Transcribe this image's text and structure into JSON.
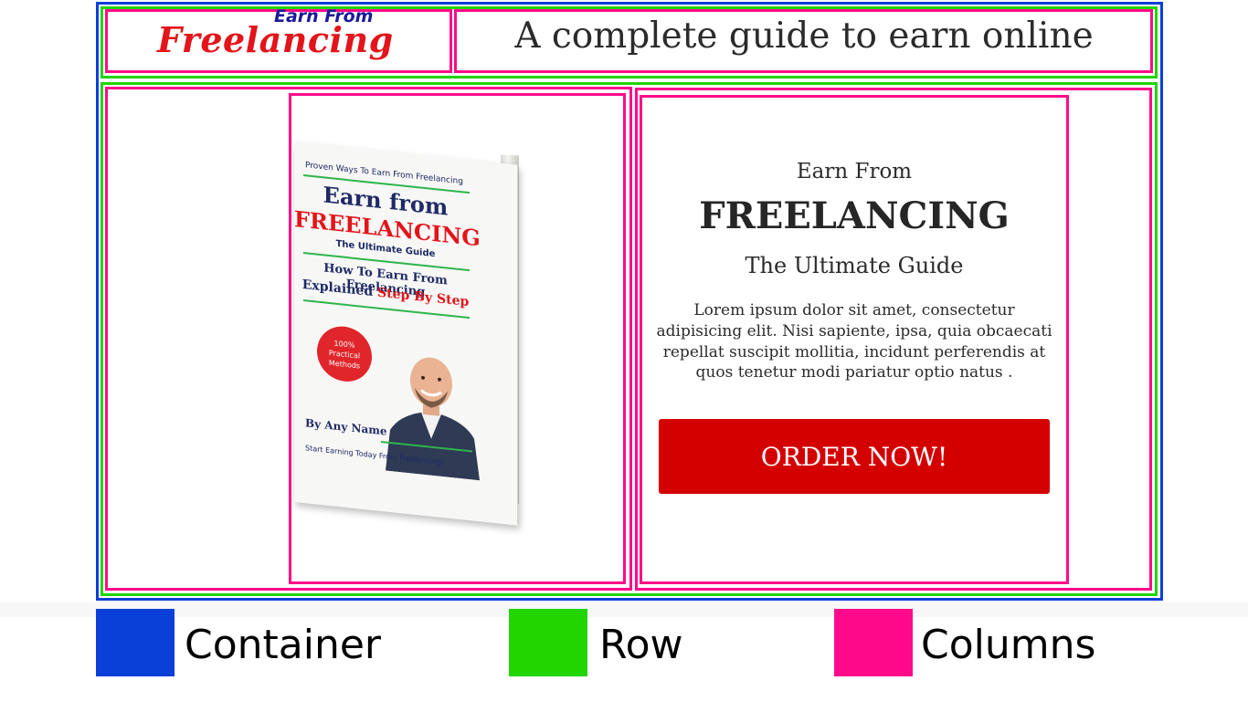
{
  "header": {
    "logo_top": "Earn From",
    "logo_main": "Freelancing",
    "title": "A complete guide to earn online"
  },
  "book_cover": {
    "top_line": "Proven Ways To Earn From Freelancing",
    "title_line1": "Earn from",
    "title_line2": "FREELANCING",
    "subtitle": "The Ultimate Guide",
    "tagline1": "How To Earn From Freelancing",
    "tagline2": "Explained",
    "tagline2_highlight": "Step By Step",
    "badge_line1": "100%",
    "badge_line2": "Practical",
    "badge_line3": "Methods",
    "author": "By Any Name",
    "bottom_line": "Start Earning Today From Freelancing!"
  },
  "product": {
    "earn_from": "Earn From",
    "heading": "FREELANCING",
    "subtitle": "The Ultimate Guide",
    "description": "Lorem ipsum dolor sit amet, consectetur adipisicing elit. Nisi sapiente, ipsa, quia obcaecati repellat suscipit mollitia, incidunt perferendis at quos tenetur modi pariatur optio natus .",
    "order_button": "ORDER NOW!"
  },
  "legend": [
    {
      "label": "Container",
      "color": "#0a3fd8"
    },
    {
      "label": "Row",
      "color": "#22d400"
    },
    {
      "label": "Columns",
      "color": "#ff0a8a"
    }
  ],
  "colors": {
    "container": "#0a3fd8",
    "row": "#22d400",
    "column": "#ff0a8a",
    "button": "#d40000",
    "logo_red": "#e3141a",
    "logo_blue": "#1c1a9a"
  }
}
